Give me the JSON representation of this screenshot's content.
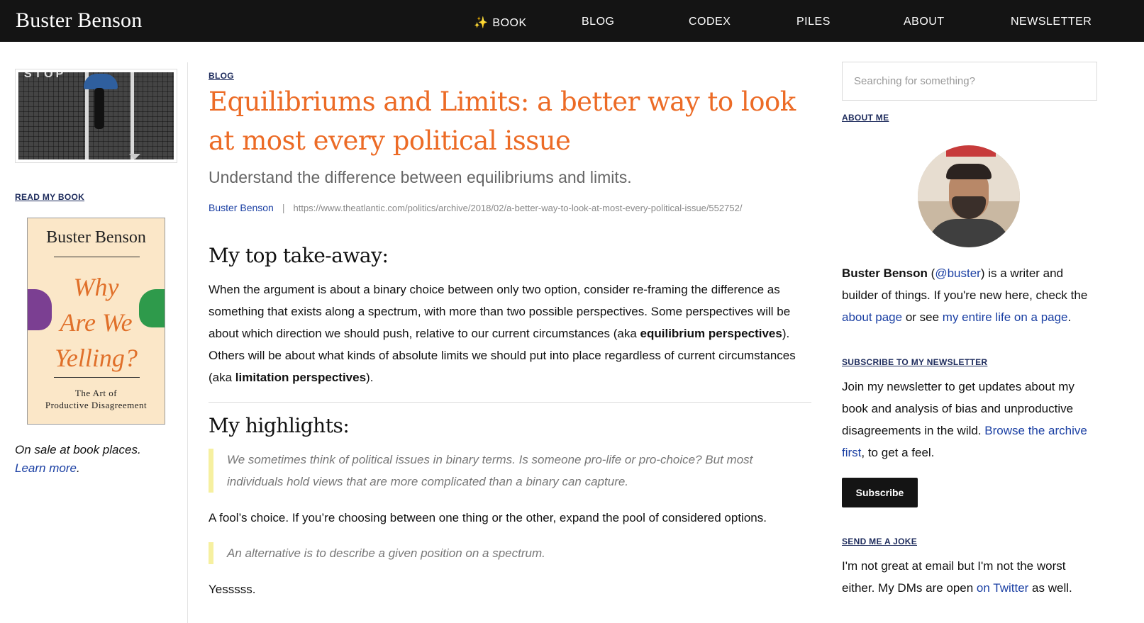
{
  "header": {
    "brand": "Buster Benson",
    "nav": [
      {
        "label": "BOOK",
        "icon": "sparkles-icon",
        "glyph": "✨"
      },
      {
        "label": "BLOG"
      },
      {
        "label": "CODEX"
      },
      {
        "label": "PILES"
      },
      {
        "label": "ABOUT"
      },
      {
        "label": "NEWSLETTER"
      }
    ]
  },
  "left": {
    "photo_text": "STOP",
    "read_label": "READ MY BOOK",
    "book": {
      "author": "Buster Benson",
      "title_lines": [
        "Why",
        "Are We",
        "Yelling?"
      ],
      "subtitle_lines": [
        "The Art of",
        "Productive Disagreement"
      ]
    },
    "caption": "On sale at book places.",
    "caption_link": "Learn more",
    "caption_end": "."
  },
  "main": {
    "breadcrumb": "BLOG",
    "title": "Equilibriums and Limits: a better way to look at most every political issue",
    "subtitle": "Understand the difference between equilibriums and limits.",
    "author": "Buster Benson",
    "separator": "|",
    "source_url": "https://www.theatlantic.com/politics/archive/2018/02/a-better-way-to-look-at-most-every-political-issue/552752/",
    "takeaway_heading": "My top take-away:",
    "takeaway": {
      "p1": "When the argument is about a binary choice between only two option, consider re-framing the difference as something that exists along a spectrum, with more than two possible perspectives. Some perspectives will be about which direction we should push, relative to our current circumstances (aka ",
      "b1": "equilibrium perspectives",
      "p2": "). Others will be about what kinds of absolute limits we should put into place regardless of current circumstances (aka ",
      "b2": "limitation perspectives",
      "p3": ")."
    },
    "highlights_heading": "My highlights:",
    "quote1": "We sometimes think of political issues in binary terms. Is someone pro-life or pro-choice? But most individuals hold views that are more complicated than a binary can capture.",
    "note1": "A fool’s choice. If you’re choosing between one thing or the other, expand the pool of considered options.",
    "quote2": "An alternative is to describe a given position on a spectrum.",
    "note2": "Yesssss."
  },
  "right": {
    "search_placeholder": "Searching for something?",
    "about_label": "ABOUT ME",
    "about": {
      "name": "Buster Benson",
      "open_paren": " (",
      "handle": "@buster",
      "t1": ") is a writer and builder of things. If you're new here, check the ",
      "link1": "about page",
      "t2": " or see ",
      "link2": "my entire life on a page",
      "t3": "."
    },
    "newsletter_label": "SUBSCRIBE TO MY NEWSLETTER",
    "newsletter": {
      "t1": "Join my newsletter to get updates about my book and analysis of bias and unproductive disagreements in the wild. ",
      "link": "Browse the archive first",
      "t2": ", to get a feel."
    },
    "subscribe_label": "Subscribe",
    "joke_label": "SEND ME A JOKE",
    "joke": {
      "t1": "I'm not great at email but I'm not the worst either. My DMs are open ",
      "link": "on Twitter",
      "t2": " as well."
    }
  },
  "colors": {
    "accent_orange": "#ec6b26",
    "link_blue": "#1a3fa3",
    "topbar": "#141414",
    "quote_bar": "#f6f0a0"
  }
}
